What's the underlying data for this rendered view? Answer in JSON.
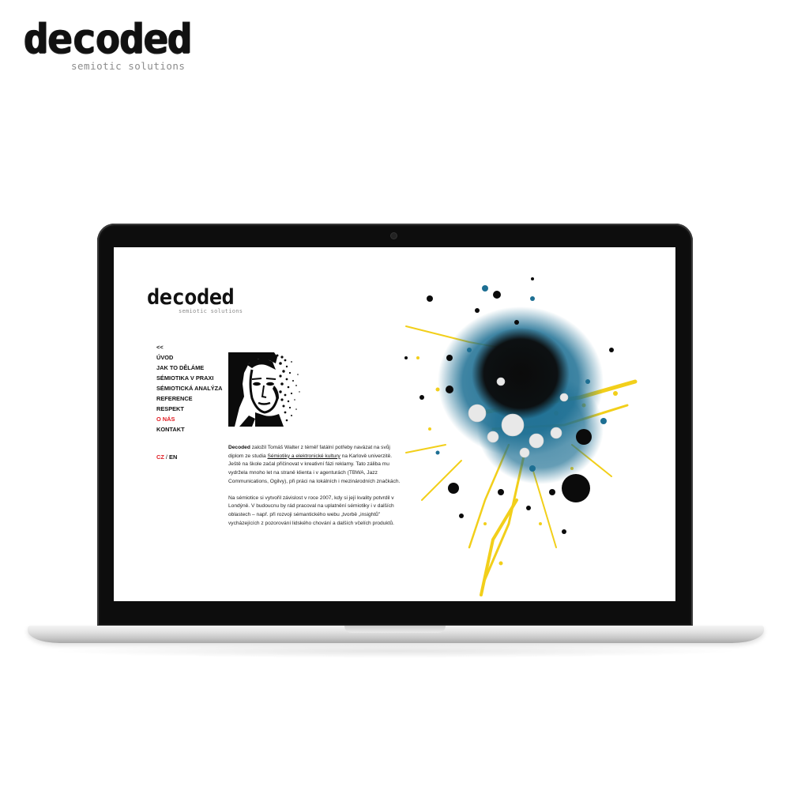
{
  "brand": {
    "word": "decoded",
    "tagline": "semiotic solutions"
  },
  "site": {
    "logo_word": "decoded",
    "logo_tagline": "semiotic solutions",
    "nav": {
      "back": "<<",
      "items": [
        "ÚVOD",
        "JAK TO DĚLÁME",
        "SÉMIOTIKA V PRAXI",
        "SÉMIOTICKÁ ANALÝZA",
        "REFERENCE",
        "RESPEKT",
        "O NÁS",
        "KONTAKT"
      ],
      "active": "O NÁS"
    },
    "lang": {
      "cz": "CZ",
      "separator": "/",
      "en": "EN"
    },
    "article": {
      "p1_bold": "Decoded",
      "p1_a": " založil Tomáš Walter z téměř fatální potřeby navázat na svůj diplom ze studia ",
      "p1_link": "Sémiotiky a elektronické kultury",
      "p1_b": " na Karlově univerzitě. Ještě na škole začal přičinovat v kreativní fázi reklamy. Tato záliba mu vydržela mnoho let na straně klienta i v agenturách (TBWA, Jazz Communications, Ogilvy), při práci na lokálních i mezinárodních značkách.",
      "p2": "Na sémiotice si vytvořil závislost v roce 2007, kdy si její kvality potvrdil v Londýně. V budoucnu by rád pracoval na uplatnění sémiotiky i v dalších oblastech – např. při rozvoji sémantického webu „tvorbě „insightů\" vycházejících z pozorování lidského chování a dalších včelích produktů."
    }
  },
  "colors": {
    "accent_red": "#e11b22",
    "splash_blue": "#1d6f93",
    "splash_yellow": "#f2cf1a",
    "splash_black": "#0b0b0b"
  }
}
